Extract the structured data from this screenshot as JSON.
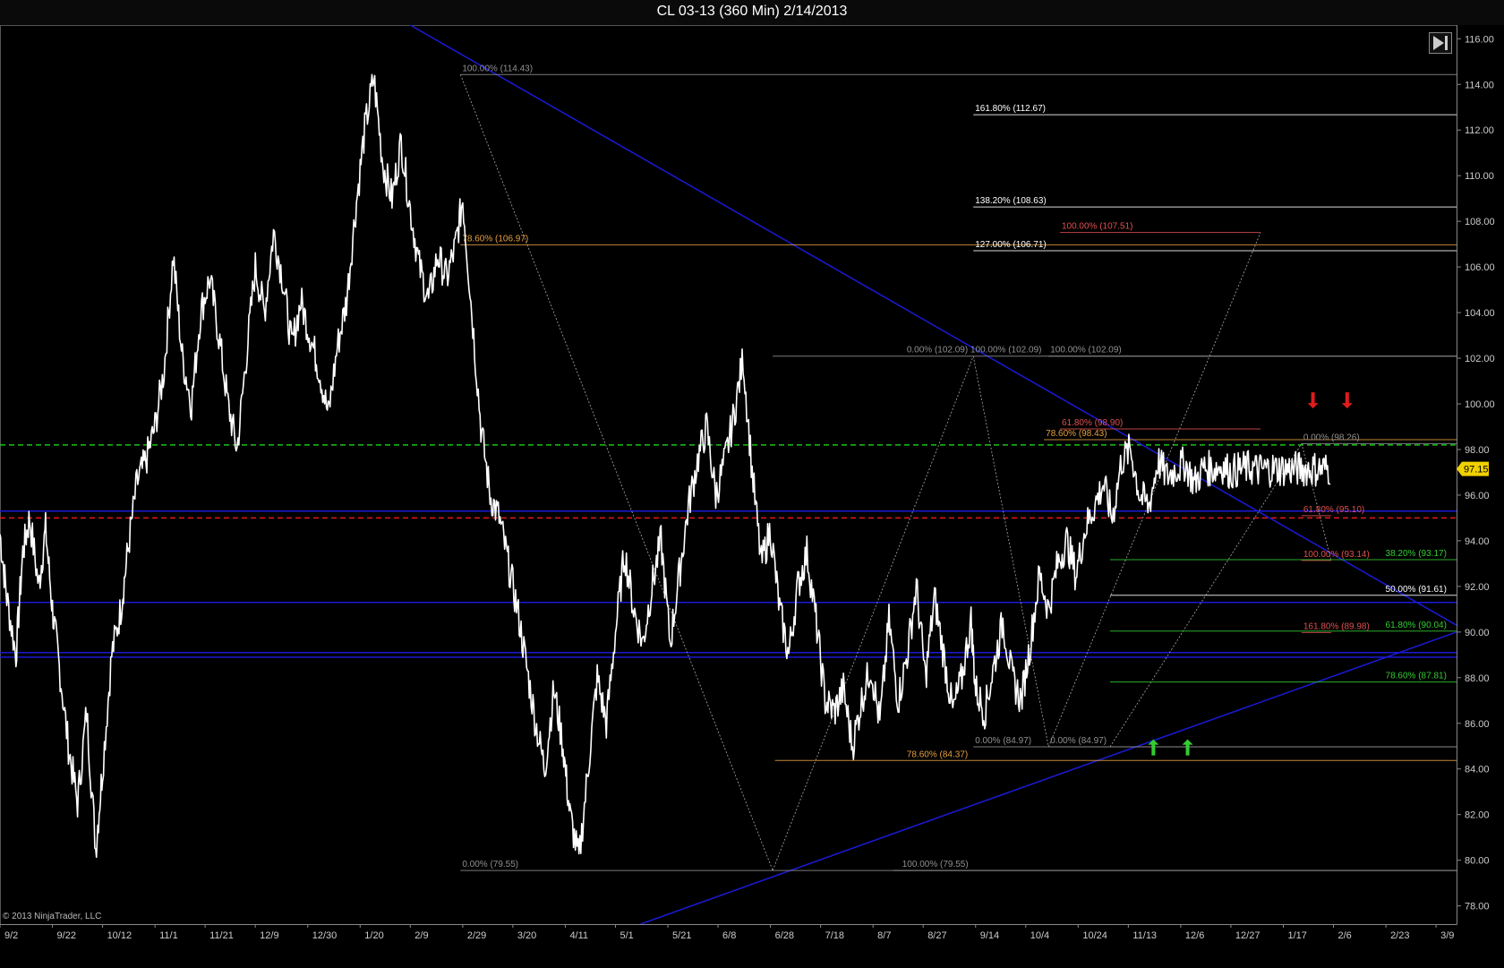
{
  "window": {
    "title": "CL 03-13 (360 Min)  2/14/2013"
  },
  "watermark": "© 2013 NinjaTrader, LLC",
  "colors": {
    "background": "#000000",
    "price": "#ffffff",
    "blue_line": "#1a1ad6",
    "green_dashed": "#19c419",
    "red_dashed": "#e01b1b",
    "fib_white": "#ffffff",
    "fib_red": "#e05050",
    "fib_orange": "#e8a040",
    "fib_green": "#33cc33",
    "fib_gray": "#909090",
    "last_price_bg": "#f0d000"
  },
  "chart_data": {
    "type": "line",
    "instrument": "CL 03-13",
    "interval": "360 Min",
    "y_axis": {
      "ylim": [
        77.2,
        116.6
      ],
      "ticks": [
        "78.00",
        "80.00",
        "82.00",
        "84.00",
        "86.00",
        "88.00",
        "90.00",
        "92.00",
        "94.00",
        "96.00",
        "98.00",
        "100.00",
        "102.00",
        "104.00",
        "106.00",
        "108.00",
        "110.00",
        "112.00",
        "114.00",
        "116.00"
      ],
      "last_price_label": "97.15",
      "last_price": 97.15
    },
    "x_axis": {
      "ticks": [
        "9/2",
        "9/22",
        "10/12",
        "11/1",
        "11/21",
        "12/9",
        "12/30",
        "1/20",
        "2/9",
        "2/29",
        "3/20",
        "4/11",
        "5/1",
        "5/21",
        "6/8",
        "6/28",
        "7/18",
        "8/7",
        "8/27",
        "9/14",
        "10/4",
        "10/24",
        "11/13",
        "12/6",
        "12/27",
        "1/17",
        "2/6",
        "2/23",
        "3/9"
      ],
      "tick_index": [
        0,
        2.3,
        4.5,
        6.8,
        9,
        11.2,
        13.5,
        15.8,
        18,
        20.3,
        22.5,
        24.8,
        27,
        29.3,
        31.5,
        33.8,
        36,
        38.3,
        40.5,
        42.8,
        45,
        47.3,
        49.5,
        51.8,
        54,
        56.3,
        58.5,
        60.8,
        63
      ]
    },
    "price_path": {
      "x": [
        0,
        0.3,
        0.7,
        1,
        1.3,
        1.7,
        2,
        2.3,
        2.6,
        3,
        3.4,
        3.8,
        4.2,
        4.5,
        4.9,
        5.3,
        5.6,
        6,
        6.4,
        6.8,
        7.2,
        7.6,
        8,
        8.4,
        8.8,
        9.2,
        9.6,
        10,
        10.4,
        10.8,
        11.2,
        11.6,
        12,
        12.4,
        12.8,
        13.2,
        13.6,
        14,
        14.4,
        14.8,
        15.2,
        15.6,
        16,
        16.4,
        16.8,
        17.2,
        17.6,
        18,
        18.4,
        18.8,
        19.2,
        19.6,
        20,
        20.3,
        20.7,
        21.1,
        21.5,
        21.9,
        22.3,
        22.7,
        23.1,
        23.5,
        23.9,
        24.3,
        24.7,
        25,
        25.4,
        25.8,
        26.2,
        26.6,
        27,
        27.4,
        27.8,
        28.2,
        28.6,
        29,
        29.4,
        29.8,
        30.2,
        30.6,
        31,
        31.4,
        31.8,
        32.2,
        32.6,
        33,
        33.4,
        33.8,
        34.2,
        34.6,
        35,
        35.4,
        35.8,
        36.2,
        36.6,
        37,
        37.4,
        37.8,
        38.2,
        38.6,
        39,
        39.4,
        39.8,
        40.2,
        40.6,
        41,
        41.4,
        41.8,
        42.2,
        42.6,
        42.8,
        43.2,
        43.6,
        44,
        44.4,
        44.8,
        45.2,
        45.6,
        46,
        46.4,
        46.8,
        47.2,
        47.6,
        48,
        48.4,
        48.8,
        49.2,
        49.6,
        50,
        50.4,
        50.8,
        51.2,
        51.6,
        52,
        52.4,
        52.8,
        53.2,
        53.6,
        54,
        54.4,
        54.8,
        55.2,
        55.6,
        56,
        56.4,
        56.8,
        57.2,
        57.6,
        58,
        58.4,
        58.8,
        59.1
      ],
      "y": [
        94.3,
        91.5,
        89.0,
        93.5,
        95.0,
        92.0,
        94.5,
        91.0,
        88.5,
        85.0,
        82.5,
        86.5,
        80.5,
        84.0,
        89.0,
        91.0,
        93.5,
        96.5,
        97.5,
        99.0,
        101.5,
        106.5,
        102.0,
        100.0,
        104.0,
        105.5,
        103.0,
        100.0,
        98.0,
        102.0,
        106.0,
        104.0,
        107.5,
        105.5,
        102.5,
        104.5,
        103.0,
        101.5,
        99.5,
        102.5,
        104.5,
        108.5,
        112.0,
        114.3,
        110.5,
        109.0,
        111.5,
        108.5,
        106.0,
        104.5,
        106.5,
        105.5,
        107.0,
        109.0,
        104.0,
        99.0,
        96.0,
        95.0,
        93.0,
        91.0,
        88.5,
        86.0,
        84.0,
        87.5,
        85.0,
        82.0,
        80.0,
        84.0,
        88.0,
        86.0,
        90.0,
        93.5,
        91.0,
        89.5,
        92.0,
        94.0,
        89.5,
        92.5,
        95.5,
        97.5,
        99.0,
        96.0,
        97.5,
        99.5,
        102.0,
        97.0,
        93.0,
        94.5,
        91.0,
        89.0,
        92.0,
        93.5,
        90.5,
        87.0,
        86.5,
        87.5,
        85.0,
        87.0,
        88.5,
        86.0,
        90.5,
        87.0,
        89.0,
        92.0,
        88.0,
        91.5,
        89.0,
        86.5,
        88.0,
        90.5,
        87.5,
        86.5,
        88.5,
        90.5,
        88.0,
        87.0,
        89.5,
        92.5,
        91.0,
        93.0,
        94.0,
        92.5,
        94.5,
        95.5,
        96.5,
        95.0,
        97.5,
        98.0,
        96.0,
        95.5,
        97.5,
        96.8,
        97.15,
        97.4,
        96.5,
        97.2,
        97.15,
        97.3,
        97.0,
        97.15,
        97.2,
        97.1,
        97.15,
        97.15,
        97.15,
        97.15,
        97.15,
        97.15,
        97.15,
        97.15
      ]
    },
    "horizontal_lines": [
      {
        "name": "green-dashed",
        "y": 98.2,
        "style": "dashed",
        "color": "#19c419"
      },
      {
        "name": "red-dashed",
        "y": 95.0,
        "style": "dashed",
        "color": "#e01b1b"
      },
      {
        "name": "blue-1",
        "y": 95.3,
        "color": "#1a1ad6"
      },
      {
        "name": "blue-2",
        "y": 91.3,
        "color": "#1a1ad6"
      },
      {
        "name": "blue-3",
        "y": 89.1,
        "color": "#1a1ad6"
      },
      {
        "name": "blue-4",
        "y": 88.9,
        "color": "#1a1ad6"
      }
    ],
    "trend_lines": [
      {
        "name": "downtrend",
        "x1": 17.3,
        "y1": 117.0,
        "x2": 63.9,
        "y2": 90.3,
        "color": "#1a1ad6"
      },
      {
        "name": "uptrend",
        "x1": 28.1,
        "y1": 77.2,
        "x2": 63.9,
        "y2": 90.0,
        "color": "#1a1ad6"
      }
    ],
    "fib_levels": [
      {
        "label": "100.00% (114.43)",
        "y": 114.43,
        "x1": 20.2,
        "x2": 63.9,
        "color": "#909090"
      },
      {
        "label": "161.80% (112.67)",
        "y": 112.67,
        "x1": 42.7,
        "x2": 63.9,
        "color": "#ffffff"
      },
      {
        "label": "138.20% (108.63)",
        "y": 108.63,
        "x1": 42.7,
        "x2": 63.9,
        "color": "#ffffff"
      },
      {
        "label": "100.00% (107.51)",
        "y": 107.51,
        "x1": 46.5,
        "x2": 55.3,
        "color": "#e05050"
      },
      {
        "label": "78.60% (106.97)",
        "y": 106.97,
        "x1": 20.2,
        "x2": 63.9,
        "color": "#e8a040"
      },
      {
        "label": "127.00% (106.71)",
        "y": 106.71,
        "x1": 42.7,
        "x2": 63.9,
        "color": "#ffffff"
      },
      {
        "label": "0.00% (102.09) 100.00% (102.09)",
        "y": 102.09,
        "x1": 33.9,
        "x2": 63.9,
        "color": "#909090"
      },
      {
        "label": "100.00% (102.09)",
        "y": 102.09,
        "x1": 46.0,
        "x2": 63.9,
        "color": "#909090"
      },
      {
        "label": "61.80% (98.90)",
        "y": 98.9,
        "x1": 46.5,
        "x2": 55.3,
        "color": "#e05050"
      },
      {
        "label": "78.60% (98.43)",
        "y": 98.43,
        "x1": 45.8,
        "x2": 63.9,
        "color": "#e8a040"
      },
      {
        "label": "0.00% (98.26)",
        "y": 98.26,
        "x1": 57.1,
        "x2": 63.9,
        "color": "#909090"
      },
      {
        "label": "61.80% (95.10)",
        "y": 95.1,
        "x1": 57.1,
        "x2": 58.4,
        "color": "#e05050"
      },
      {
        "label": "100.00% (93.14)",
        "y": 93.14,
        "x1": 57.1,
        "x2": 58.4,
        "color": "#e05050"
      },
      {
        "label": "38.20% (93.17)",
        "y": 93.17,
        "x1": 48.7,
        "x2": 63.9,
        "color": "#33cc33"
      },
      {
        "label": "50.00% (91.61)",
        "y": 91.61,
        "x1": 48.7,
        "x2": 63.9,
        "color": "#ffffff"
      },
      {
        "label": "61.80% (90.04)",
        "y": 90.04,
        "x1": 48.7,
        "x2": 63.9,
        "color": "#33cc33"
      },
      {
        "label": "161.80% (89.98)",
        "y": 89.98,
        "x1": 57.1,
        "x2": 58.4,
        "color": "#e05050"
      },
      {
        "label": "78.60% (87.81)",
        "y": 87.81,
        "x1": 48.7,
        "x2": 63.9,
        "color": "#33cc33"
      },
      {
        "label": "0.00% (84.97)",
        "y": 84.97,
        "x1": 42.7,
        "x2": 63.9,
        "color": "#909090"
      },
      {
        "label": "0.00% (84.97)",
        "y": 84.97,
        "x1": 46.0,
        "x2": 63.9,
        "color": "#909090"
      },
      {
        "label": "78.60% (84.37)",
        "y": 84.37,
        "x1": 34.0,
        "x2": 63.9,
        "color": "#e8a040"
      },
      {
        "label": "0.00% (79.55)",
        "y": 79.55,
        "x1": 20.2,
        "x2": 63.9,
        "color": "#909090"
      },
      {
        "label": "100.00% (79.55)",
        "y": 79.55,
        "x1": 39.2,
        "x2": 63.9,
        "color": "#909090"
      }
    ],
    "label_positions": [
      {
        "i": 0,
        "lx": 20.2,
        "ly": 114.43
      },
      {
        "i": 1,
        "lx": 42.7,
        "ly": 112.67
      },
      {
        "i": 2,
        "lx": 42.7,
        "ly": 108.63
      },
      {
        "i": 3,
        "lx": 46.5,
        "ly": 107.51
      },
      {
        "i": 4,
        "lx": 20.2,
        "ly": 106.97
      },
      {
        "i": 5,
        "lx": 42.7,
        "ly": 106.71
      },
      {
        "i": 6,
        "lx": 39.7,
        "ly": 102.09
      },
      {
        "i": 7,
        "lx": 46.0,
        "ly": 102.09
      },
      {
        "i": 8,
        "lx": 46.5,
        "ly": 98.9
      },
      {
        "i": 9,
        "lx": 45.8,
        "ly": 98.43
      },
      {
        "i": 10,
        "lx": 57.1,
        "ly": 98.26
      },
      {
        "i": 11,
        "lx": 57.1,
        "ly": 95.1
      },
      {
        "i": 12,
        "lx": 57.1,
        "ly": 93.14
      },
      {
        "i": 13,
        "lx": 60.7,
        "ly": 93.17
      },
      {
        "i": 14,
        "lx": 60.7,
        "ly": 91.61
      },
      {
        "i": 15,
        "lx": 60.7,
        "ly": 90.04
      },
      {
        "i": 16,
        "lx": 57.1,
        "ly": 89.98
      },
      {
        "i": 17,
        "lx": 60.7,
        "ly": 87.81
      },
      {
        "i": 18,
        "lx": 42.7,
        "ly": 84.97
      },
      {
        "i": 19,
        "lx": 46.0,
        "ly": 84.97
      },
      {
        "i": 20,
        "lx": 39.7,
        "ly": 84.37
      },
      {
        "i": 21,
        "lx": 20.2,
        "ly": 79.55
      },
      {
        "i": 22,
        "lx": 39.5,
        "ly": 79.55
      }
    ],
    "swing_lines": [
      {
        "x": [
          20.2,
          33.9
        ],
        "y": [
          114.43,
          79.55
        ]
      },
      {
        "x": [
          33.9,
          42.7
        ],
        "y": [
          79.55,
          102.09
        ]
      },
      {
        "x": [
          42.7,
          46.0
        ],
        "y": [
          102.09,
          84.97
        ]
      },
      {
        "x": [
          46.0,
          55.3
        ],
        "y": [
          84.97,
          107.51
        ]
      },
      {
        "x": [
          48.7,
          57.1
        ],
        "y": [
          84.97,
          98.26
        ]
      },
      {
        "x": [
          57.1,
          58.4
        ],
        "y": [
          98.26,
          93.14
        ]
      }
    ],
    "arrows": [
      {
        "name": "red-down-arrow-1",
        "x": 57.6,
        "y": 99.8,
        "dir": "down",
        "color": "#e01b1b"
      },
      {
        "name": "red-down-arrow-2",
        "x": 59.1,
        "y": 99.8,
        "dir": "down",
        "color": "#e01b1b"
      },
      {
        "name": "green-up-arrow-1",
        "x": 50.6,
        "y": 85.3,
        "dir": "up",
        "color": "#33cc33"
      },
      {
        "name": "green-up-arrow-2",
        "x": 52.1,
        "y": 85.3,
        "dir": "up",
        "color": "#33cc33"
      }
    ],
    "xlim": [
      0,
      63.9
    ]
  }
}
